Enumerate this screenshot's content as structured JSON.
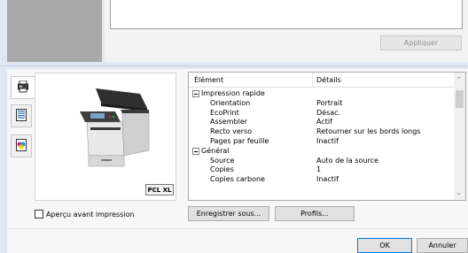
{
  "top": {
    "apply_label": "Appliquer"
  },
  "side_tabs": [
    {
      "icon": "printer-settings-icon"
    },
    {
      "icon": "document-list-icon"
    },
    {
      "icon": "color-palette-icon"
    }
  ],
  "preview": {
    "pdl_badge": "PCL XL"
  },
  "tree": {
    "col_element": "Élément",
    "col_details": "Détails",
    "rows": [
      {
        "element": "Impression rapide",
        "value": "",
        "group": true
      },
      {
        "element": "Orientation",
        "value": "Portrait",
        "group": false
      },
      {
        "element": "EcoPrint",
        "value": "Désac.",
        "group": false
      },
      {
        "element": "Assembler",
        "value": "Actif",
        "group": false
      },
      {
        "element": "Recto verso",
        "value": "Retourner sur les bords longs",
        "group": false
      },
      {
        "element": "Pages par feuille",
        "value": "Inactif",
        "group": false
      },
      {
        "element": "Général",
        "value": "",
        "group": true
      },
      {
        "element": "Source",
        "value": "Auto de la source",
        "group": false
      },
      {
        "element": "Copies",
        "value": "1",
        "group": false
      },
      {
        "element": "Copies carbone",
        "value": "Inactif",
        "group": false
      }
    ]
  },
  "preview_checkbox": {
    "label": "Aperçu avant impression",
    "checked": false
  },
  "buttons": {
    "save_as": "Enregistrer sous...",
    "profiles": "Profils...",
    "ok": "OK",
    "cancel": "Annuler"
  }
}
